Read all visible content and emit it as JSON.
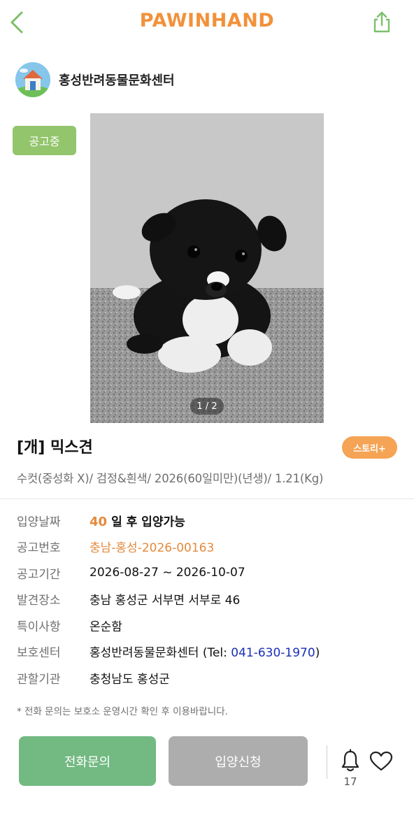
{
  "header": {
    "logo_text": "PAWINHAND",
    "back_icon": "chevron-left-icon",
    "share_icon": "share-icon"
  },
  "shelter": {
    "name": "홍성반려동물문화센터",
    "avatar_icon": "shelter-house-icon"
  },
  "status_badge": "공고중",
  "photo": {
    "counter": "1 / 2"
  },
  "animal": {
    "title": "[개] 믹스견",
    "description": "수컷(중성화 X)/ 검정&흰색/ 2026(60일미만)(년생)/ 1.21(Kg)",
    "story_button": "스토리+"
  },
  "details": {
    "adopt_date": {
      "label": "입양날짜",
      "days": "40",
      "text": "일 후 입양가능"
    },
    "notice_no": {
      "label": "공고번호",
      "value": "충남-홍성-2026-00163"
    },
    "notice_period": {
      "label": "공고기간",
      "value": "2026-08-27 ~ 2026-10-07"
    },
    "found_place": {
      "label": "발견장소",
      "value": "충남 홍성군 서부면 서부로 46"
    },
    "feature": {
      "label": "특이사항",
      "value": "온순함"
    },
    "shelter": {
      "label": "보호센터",
      "name": "홍성반려동물문화센터",
      "tel_prefix": "(Tel: ",
      "tel": "041-630-1970",
      "tel_suffix": ")"
    },
    "agency": {
      "label": "관할기관",
      "value": "충청남도 홍성군"
    }
  },
  "notice_text": "* 전화 문의는 보호소 운영시간 확인 후 이용바랍니다.",
  "actions": {
    "call_label": "전화문의",
    "adopt_label": "입양신청",
    "bell_icon": "bell-icon",
    "bell_count": "17",
    "heart_icon": "heart-icon"
  },
  "colors": {
    "brand_orange": "#f2913a",
    "green": "#72b982",
    "badge_green": "#93c56c",
    "story_orange": "#f5a354",
    "link_blue": "#1a2fb6",
    "disabled_gray": "#adadad"
  }
}
